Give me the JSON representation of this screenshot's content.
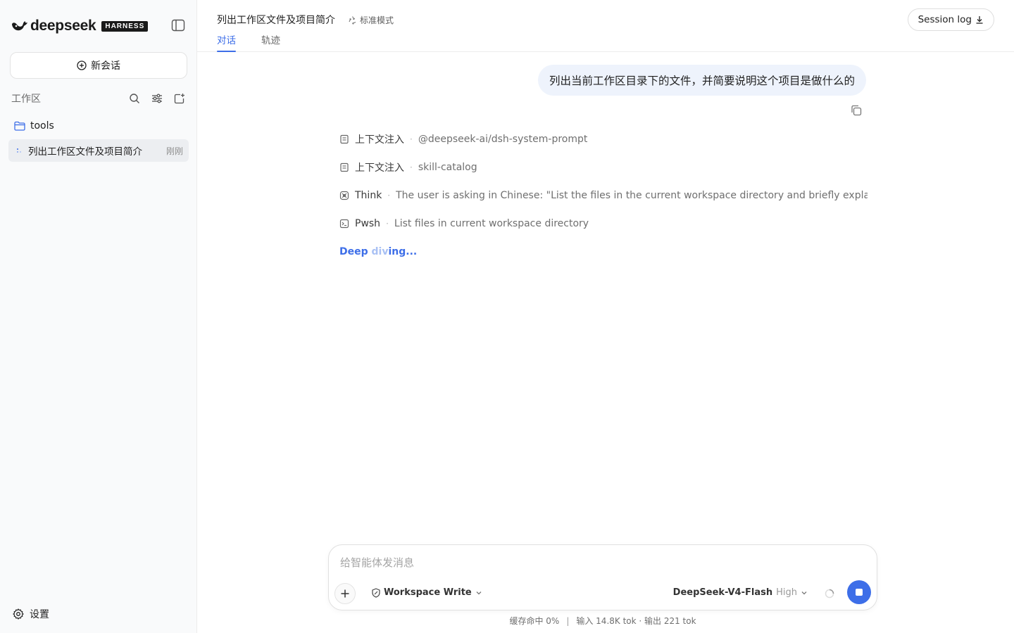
{
  "brand": {
    "name": "deepseek",
    "badge": "HARNESS"
  },
  "sidebar": {
    "new_chat_label": "新会话",
    "workspace_label": "工作区",
    "folder": {
      "name": "tools"
    },
    "sessions": [
      {
        "title": "列出工作区文件及项目简介",
        "time": "刚刚"
      }
    ],
    "settings_label": "设置"
  },
  "header": {
    "title": "列出工作区文件及项目简介",
    "mode": "标准模式",
    "tabs": [
      {
        "label": "对话",
        "active": true
      },
      {
        "label": "轨迹",
        "active": false
      }
    ],
    "session_log_label": "Session log"
  },
  "chat": {
    "user_message": "列出当前工作区目录下的文件，并简要说明这个项目是做什么的",
    "steps": [
      {
        "icon": "document-icon",
        "name": "上下文注入",
        "desc": "@deepseek-ai/dsh-system-prompt"
      },
      {
        "icon": "document-icon",
        "name": "上下文注入",
        "desc": "skill-catalog"
      },
      {
        "icon": "brain-icon",
        "name": "Think",
        "desc": "The user is asking in Chinese: \"List the files in the current workspace directory and briefly explain what this ..."
      },
      {
        "icon": "terminal-icon",
        "name": "Pwsh",
        "desc": "List files in current workspace directory"
      }
    ],
    "status": {
      "part1": "Deep ",
      "part2": "div",
      "part3": "ing..."
    }
  },
  "composer": {
    "placeholder": "给智能体发消息",
    "permission": "Workspace Write",
    "model": "DeepSeek-V4-Flash",
    "effort": "High"
  },
  "footer": {
    "cache": "缓存命中 0%",
    "separator": "|",
    "tokens": "输入 14.8K tok · 输出 221 tok"
  },
  "colors": {
    "accent": "#3d6ee8",
    "bubble": "#eef3fc",
    "sidebar_bg": "#f9fafb"
  }
}
